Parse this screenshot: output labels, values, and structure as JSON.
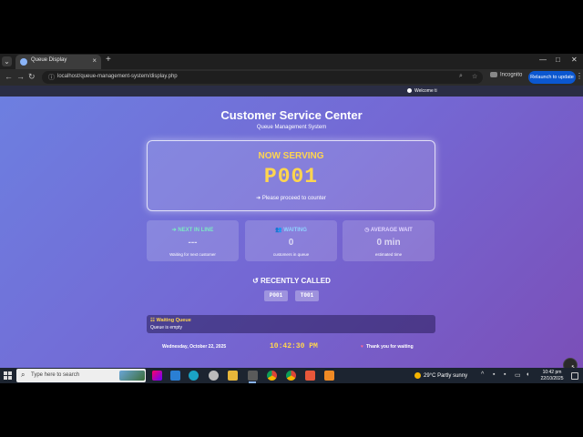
{
  "browser": {
    "tab_title": "Queue Display",
    "tab_close": "×",
    "new_tab": "+",
    "url": "localhost/queue-management-system/display.php",
    "incognito_label": "Incognito",
    "relaunch_label": "Relaunch to update"
  },
  "topbar": {
    "welcome": "Welcome ti"
  },
  "header": {
    "title": "Customer Service Center",
    "subtitle": "Queue Management System"
  },
  "serving": {
    "label": "NOW SERVING",
    "number": "P001",
    "note": "➔ Please proceed to counter"
  },
  "cards": [
    {
      "title": "➔ NEXT IN LINE",
      "value": "---",
      "sub": "Waiting for next customer",
      "color": "#7be8c4"
    },
    {
      "title": "👥 WAITING",
      "value": "0",
      "sub": "customers in queue",
      "color": "#8fd3ff"
    },
    {
      "title": "◷ AVERAGE WAIT",
      "value": "0 min",
      "sub": "estimated time",
      "color": "#e0d4ff"
    }
  ],
  "recent": {
    "title": "↺ RECENTLY CALLED",
    "items": [
      "P001",
      "T001"
    ]
  },
  "queue": {
    "title": "☷ Waiting Queue",
    "empty": "Queue is empty"
  },
  "footer": {
    "date": "Wednesday, October 22, 2025",
    "time": "10:42:30 PM",
    "thanks": "Thank you for waiting"
  },
  "taskbar": {
    "search_placeholder": "Type here to search",
    "weather": "29°C  Partly sunny",
    "time": "10:42 pm",
    "date": "22/10/2025"
  },
  "colors": {
    "accent": "#ffd54f",
    "page_gradient_start": "#6d7fe0",
    "page_gradient_end": "#7b4fb8"
  }
}
